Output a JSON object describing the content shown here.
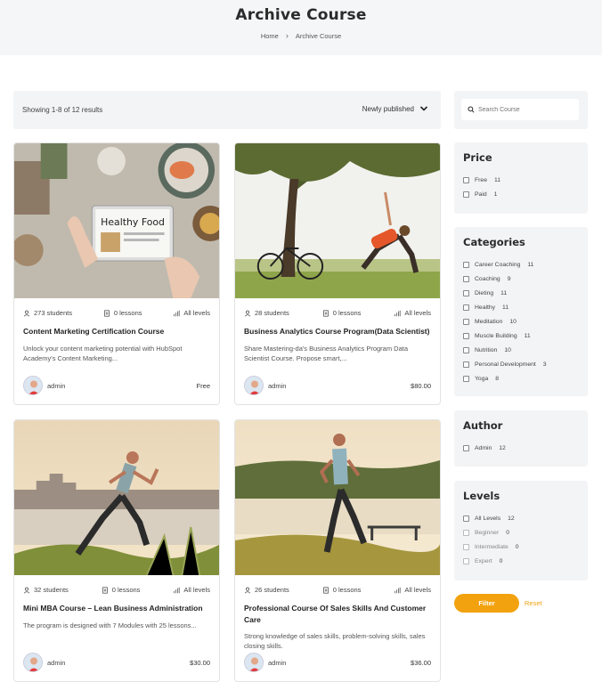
{
  "header": {
    "title": "Archive Course",
    "breadcrumb": {
      "home": "Home",
      "separator": "›",
      "current": "Archive Course"
    }
  },
  "toolbar": {
    "results_text": "Showing 1-8 of 12 results",
    "sort_value": "Newly published"
  },
  "courses": [
    {
      "students": "273 students",
      "lessons": "0 lessons",
      "level": "All levels",
      "title": "Content Marketing Certification Course",
      "description": "Unlock your content marketing potential with HubSpot Academy's Content Marketing...",
      "author": "admin",
      "price": "Free",
      "image_label": "Healthy Food"
    },
    {
      "students": "28 students",
      "lessons": "0 lessons",
      "level": "All levels",
      "title": "Business Analytics Course Program(Data Scientist)",
      "description": "Share Mastering-da's Business Analytics Program Data Scientist Course. Propose smart,...",
      "author": "admin",
      "price": "$80.00"
    },
    {
      "students": "32 students",
      "lessons": "0 lessons",
      "level": "All levels",
      "title": "Mini MBA Course – Lean Business Administration",
      "description": "The program is designed with 7 Modules with 25 lessons...",
      "author": "admin",
      "price": "$30.00"
    },
    {
      "students": "26 students",
      "lessons": "0 lessons",
      "level": "All levels",
      "title": "Professional Course Of Sales Skills And Customer Care",
      "description": "Strong knowledge of sales skills, problem-solving skills, sales closing skills.",
      "author": "admin",
      "price": "$36.00"
    }
  ],
  "sidebar": {
    "search_placeholder": "Search Course",
    "price": {
      "title": "Price",
      "items": [
        {
          "label": "Free",
          "count": "11"
        },
        {
          "label": "Paid",
          "count": "1"
        }
      ]
    },
    "categories": {
      "title": "Categories",
      "items": [
        {
          "label": "Career Coaching",
          "count": "11"
        },
        {
          "label": "Coaching",
          "count": "9"
        },
        {
          "label": "Dieting",
          "count": "11"
        },
        {
          "label": "Healthy",
          "count": "11"
        },
        {
          "label": "Meditation",
          "count": "10"
        },
        {
          "label": "Muscle Building",
          "count": "11"
        },
        {
          "label": "Nutrition",
          "count": "10"
        },
        {
          "label": "Personal Development",
          "count": "3"
        },
        {
          "label": "Yoga",
          "count": "8"
        }
      ]
    },
    "author": {
      "title": "Author",
      "items": [
        {
          "label": "Admin",
          "count": "12"
        }
      ]
    },
    "levels": {
      "title": "Levels",
      "items": [
        {
          "label": "All Levels",
          "count": "12"
        },
        {
          "label": "Beginner",
          "count": "0"
        },
        {
          "label": "Intermediate",
          "count": "0"
        },
        {
          "label": "Expert",
          "count": "0"
        }
      ]
    },
    "filter_label": "Filter",
    "reset_label": "Reset"
  },
  "colors": {
    "accent": "#f2a20e",
    "panel": "#f3f4f6"
  }
}
